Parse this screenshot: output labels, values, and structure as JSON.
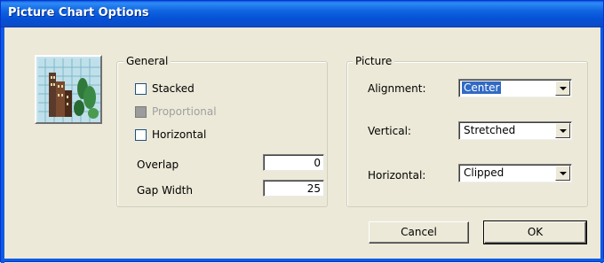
{
  "window": {
    "title": "Picture Chart Options"
  },
  "general": {
    "legend": "General",
    "stacked": {
      "label": "Stacked",
      "checked": false
    },
    "proportional": {
      "label": "Proportional",
      "checked": false,
      "disabled": true
    },
    "horizontal": {
      "label": "Horizontal",
      "checked": false
    },
    "overlap": {
      "label": "Overlap",
      "value": "0"
    },
    "gap_width": {
      "label": "Gap Width",
      "value": "25"
    }
  },
  "picture": {
    "legend": "Picture",
    "alignment": {
      "label": "Alignment:",
      "value": "Center"
    },
    "vertical": {
      "label": "Vertical:",
      "value": "Stretched"
    },
    "horizontal": {
      "label": "Horizontal:",
      "value": "Clipped"
    }
  },
  "buttons": {
    "cancel": "Cancel",
    "ok": "OK"
  },
  "colors": {
    "titlebar": "#0a5fd8",
    "dialog_bg": "#ece9d8",
    "selection": "#316ac5"
  }
}
